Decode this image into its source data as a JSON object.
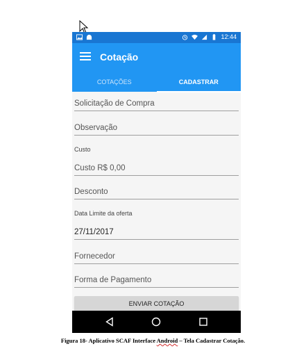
{
  "status_bar": {
    "time": "12:44",
    "left_icons": [
      "image-icon",
      "android-icon"
    ],
    "right_icons": [
      "alarm-icon",
      "wifi-icon",
      "signal-icon",
      "battery-icon"
    ]
  },
  "app_bar": {
    "title": "Cotação",
    "menu_icon": "menu-icon",
    "color": "#2196f3",
    "status_color": "#1976d2"
  },
  "tabs": [
    {
      "label": "COTAÇÕES",
      "active": false
    },
    {
      "label": "CADASTRAR",
      "active": true
    }
  ],
  "form": {
    "solicitacao": "Solicitação de Compra",
    "observacao": "Observação",
    "custo_caption": "Custo",
    "custo": "Custo R$ 0,00",
    "desconto": "Desconto",
    "data_caption": "Data Limite da oferta",
    "data": "27/11/2017",
    "fornecedor": "Fornecedor",
    "forma_pagamento": "Forma de Pagamento",
    "submit_label": "ENVIAR COTAÇÃO"
  },
  "nav_bar": {
    "buttons": [
      "back-icon",
      "home-icon",
      "recents-icon"
    ]
  },
  "caption": {
    "prefix": "Figura 18- Aplicativo SCAF Interface ",
    "highlight": "Android",
    "suffix": " – Tela Cadastrar Cotação."
  }
}
